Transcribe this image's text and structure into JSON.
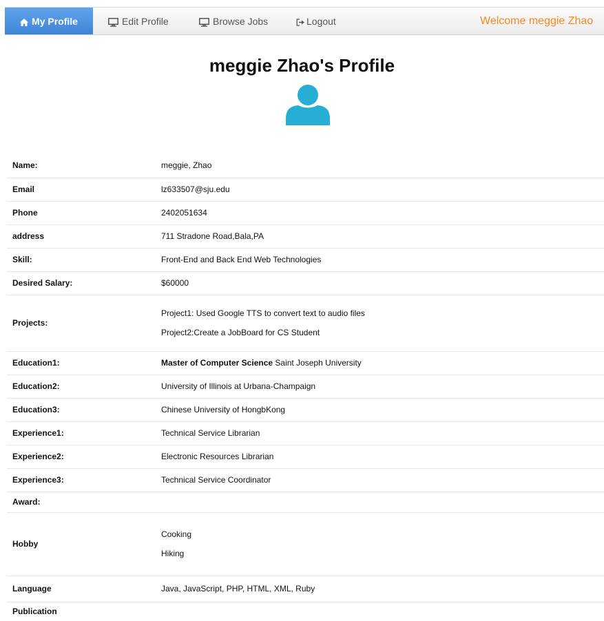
{
  "nav": {
    "items": [
      {
        "label": "My Profile",
        "icon": "home-icon"
      },
      {
        "label": "Edit Profile",
        "icon": "monitor-icon"
      },
      {
        "label": "Browse Jobs",
        "icon": "monitor-icon"
      },
      {
        "label": "Logout",
        "icon": "logout-icon"
      }
    ],
    "welcome": "Welcome meggie Zhao"
  },
  "page_title": "meggie Zhao's Profile",
  "colors": {
    "accent": "#3f83d8",
    "welcome": "#f5891f",
    "avatar": "#26aed4"
  },
  "profile": {
    "name": {
      "label": "Name:",
      "value": "meggie, Zhao"
    },
    "email": {
      "label": "Email",
      "value": "lz633507@sju.edu"
    },
    "phone": {
      "label": "Phone",
      "value": "2402051634"
    },
    "address": {
      "label": "address",
      "value": "711 Stradone Road,Bala,PA"
    },
    "skill": {
      "label": "Skill:",
      "value": "Front-End and Back End Web Technologies"
    },
    "salary": {
      "label": "Desired Salary:",
      "value": "$60000"
    },
    "projects": {
      "label": "Projects:",
      "values": [
        "Project1: Used Google TTS to convert text to audio files",
        "Project2:Create a JobBoard for CS Student"
      ]
    },
    "education1": {
      "label": "Education1:",
      "degree": "Master of Computer Science",
      "school": "Saint Joseph University"
    },
    "education2": {
      "label": "Education2:",
      "value": "University of Illinois at Urbana-Champaign"
    },
    "education3": {
      "label": "Education3:",
      "value": "Chinese University of HongbKong"
    },
    "experience1": {
      "label": "Experience1:",
      "value": "Technical Service Librarian"
    },
    "experience2": {
      "label": "Experience2:",
      "value": "Electronic Resources Librarian"
    },
    "experience3": {
      "label": "Experience3:",
      "value": "Technical Service Coordinator"
    },
    "award": {
      "label": "Award:",
      "value": ""
    },
    "hobby": {
      "label": "Hobby",
      "values": [
        "Cooking",
        "Hiking"
      ]
    },
    "language": {
      "label": "Language",
      "value": "Java, JavaScript, PHP, HTML, XML, Ruby"
    },
    "publication": {
      "label": "Publication",
      "value": ""
    }
  }
}
